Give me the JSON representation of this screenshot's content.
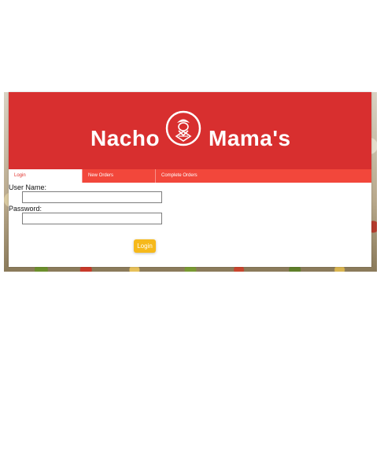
{
  "brand": {
    "name_left": "Nacho",
    "name_right": "Mama's",
    "logo_icon": "chef-logo-icon",
    "color": "#d82f2f"
  },
  "tabs": [
    {
      "label": "Login",
      "active": true
    },
    {
      "label": "New Orders",
      "active": false
    },
    {
      "label": "Complete Orders",
      "active": false
    }
  ],
  "form": {
    "username_label": "User Name:",
    "username_value": "",
    "password_label": "Password:",
    "password_value": "",
    "submit_label": "Login"
  },
  "colors": {
    "tab_bar": "#f2473b",
    "button": "#f6b91b"
  }
}
